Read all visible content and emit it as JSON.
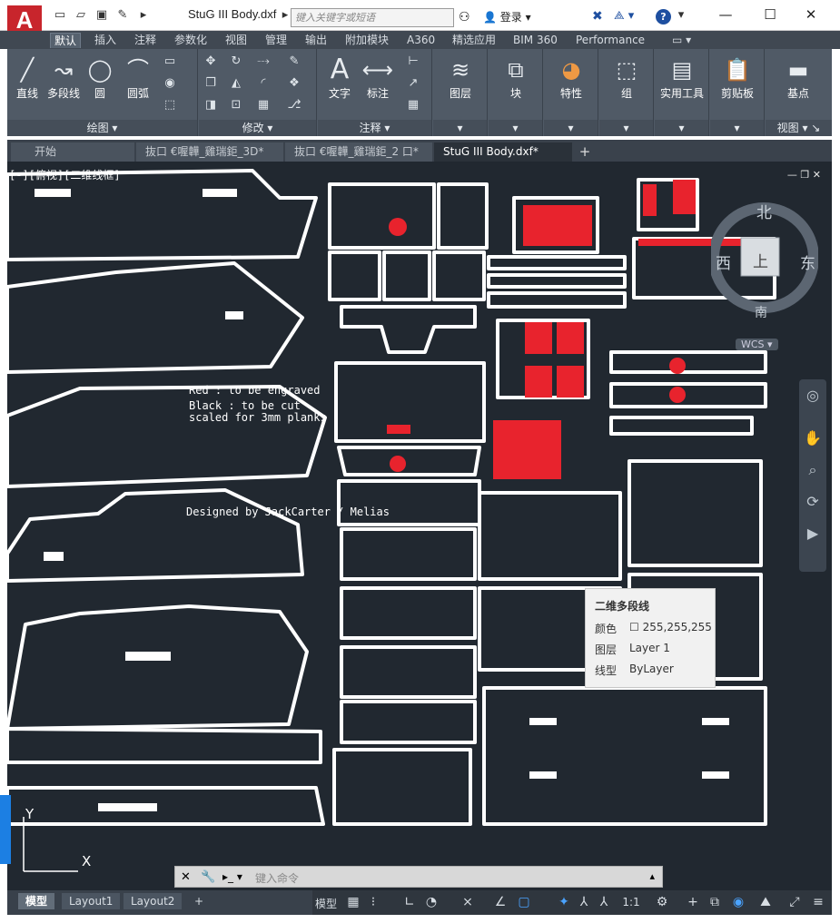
{
  "app": {
    "logo_letter": "A",
    "document_title": "StuG III Body.dxf",
    "search_placeholder": "键入关键字或短语",
    "login_label": "登录",
    "help_label": "?"
  },
  "ribbon_tabs": [
    "默认",
    "插入",
    "注释",
    "参数化",
    "视图",
    "管理",
    "输出",
    "附加模块",
    "A360",
    "精选应用",
    "BIM 360",
    "Performance"
  ],
  "ribbon": {
    "draw_panel": {
      "title": "绘图",
      "tools": [
        "直线",
        "多段线",
        "圆",
        "圆弧"
      ]
    },
    "modify_panel": {
      "title": "修改"
    },
    "annotation_panel": {
      "title": "注释",
      "tools": [
        "文字",
        "标注"
      ]
    },
    "layers_panel": {
      "tool": "图层"
    },
    "block_panel": {
      "tool": "块"
    },
    "properties_panel": {
      "tool": "特性"
    },
    "groups_panel": {
      "tool": "组"
    },
    "utilities_panel": {
      "tool": "实用工具"
    },
    "clipboard_panel": {
      "tool": "剪贴板"
    },
    "view_panel": {
      "title": "视图",
      "tool": "基点"
    }
  },
  "doc_tabs": [
    {
      "label": "开始",
      "active": false
    },
    {
      "label": "抜口 €喔韡_雞瑞鉅_3D*",
      "active": false
    },
    {
      "label": "抜口 €喔韡_雞瑞鉅_2 口*",
      "active": false
    },
    {
      "label": "StuG III Body.dxf*",
      "active": true
    }
  ],
  "canvas": {
    "viewport_label": "[-][俯视][二维线框]",
    "note_red": "Red : to be engraved",
    "note_black": "Black : to be cut",
    "note_scale": "scaled for 3mm planks",
    "designed_by": "Designed by JackCarter / Melias",
    "compass": {
      "north": "北",
      "east": "东",
      "west": "西",
      "south": "南",
      "top": "上"
    },
    "wcs_label": "WCS",
    "ucs_x": "X",
    "ucs_y": "Y"
  },
  "tooltip": {
    "title": "二维多段线",
    "rows": [
      {
        "label": "颜色",
        "value": "255,255,255"
      },
      {
        "label": "图层",
        "value": "Layer 1"
      },
      {
        "label": "线型",
        "value": "ByLayer"
      }
    ]
  },
  "command_line": {
    "placeholder": "键入命令"
  },
  "status_bar": {
    "layout_tabs": [
      "模型",
      "Layout1",
      "Layout2"
    ],
    "active_tab": "模型",
    "model_button": "模型",
    "scale": "1:1"
  },
  "colors": {
    "canvas_bg": "#212830",
    "engrave_red": "#e8232d",
    "cut_white": "#ffffff",
    "ribbon_bg": "#505a66",
    "title_logo_red": "#c8252c"
  },
  "icons": [
    "new-icon",
    "open-icon",
    "save-icon",
    "saveas-icon",
    "binoculars-icon",
    "user-icon",
    "exchange-icon",
    "a360-icon",
    "help-icon",
    "minimize-icon",
    "maximize-icon",
    "close-icon",
    "pan-icon",
    "zoom-icon",
    "orbit-icon",
    "showmotion-icon",
    "steeringwheel-icon",
    "grid-icon",
    "snap-icon",
    "ortho-icon",
    "polar-icon",
    "osnap-icon",
    "lineweight-icon",
    "annotation-scale-icon",
    "settings-icon",
    "plus-icon",
    "isolate-icon",
    "hardware-icon",
    "fullscreen-icon",
    "customize-icon"
  ]
}
